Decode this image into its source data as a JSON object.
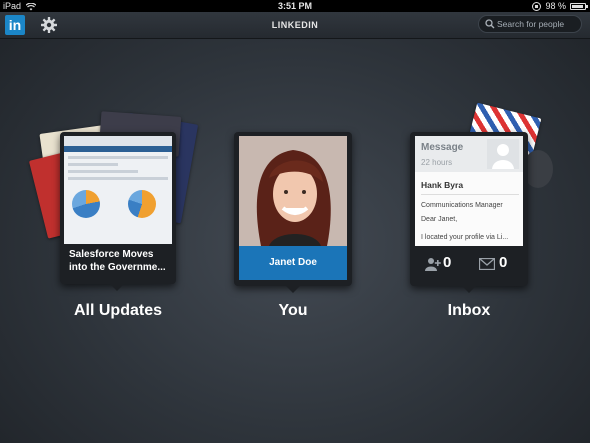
{
  "status_bar": {
    "carrier": "iPad",
    "time": "3:51 PM",
    "battery": "98 %"
  },
  "nav": {
    "title": "LINKEDIN",
    "logo_text": "in",
    "search_placeholder": "Search for people"
  },
  "tiles": {
    "updates": {
      "caption": "Salesforce Moves into the Governme...",
      "label": "All Updates"
    },
    "you": {
      "name": "Janet Doe",
      "label": "You"
    },
    "inbox": {
      "header": "Message",
      "age": "22 hours",
      "sender": "Hank Byra",
      "title": "Communications Manager",
      "greeting": "Dear Janet,",
      "preview": "I located your profile via Li...",
      "invitations_count": "0",
      "messages_count": "0",
      "label": "Inbox"
    }
  },
  "colors": {
    "brand": "#1b86c7",
    "nameplate": "#1b75b8"
  }
}
